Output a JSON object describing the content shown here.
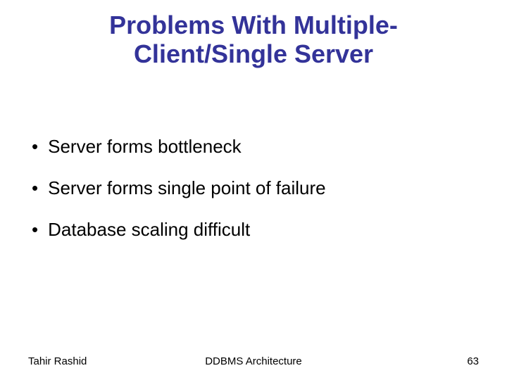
{
  "title": "Problems With Multiple-Client/Single Server",
  "bullets": [
    "Server forms bottleneck",
    "Server forms single point of failure",
    "Database scaling difficult"
  ],
  "footer": {
    "left": "Tahir Rashid",
    "center": "DDBMS Architecture",
    "right": "63"
  }
}
